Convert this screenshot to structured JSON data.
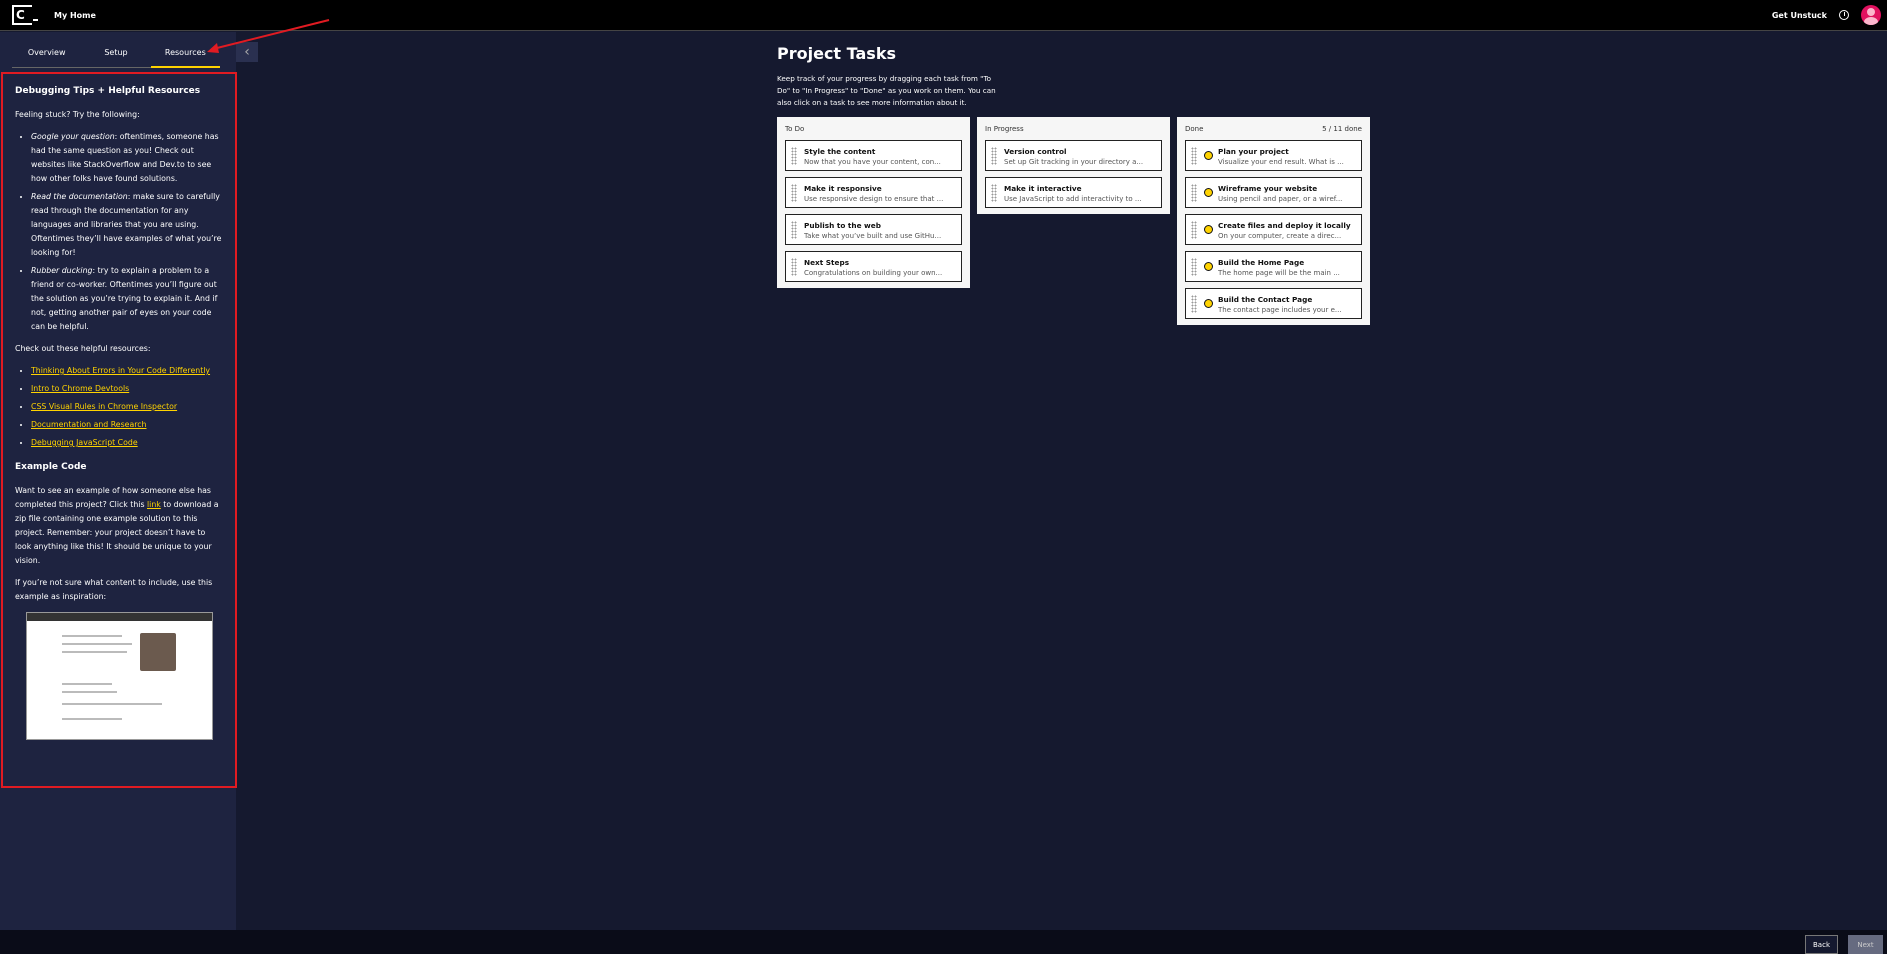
{
  "topbar": {
    "app_title": "My Home",
    "get_unstuck": "Get Unstuck"
  },
  "sidebar": {
    "tabs": [
      {
        "label": "Overview"
      },
      {
        "label": "Setup"
      },
      {
        "label": "Resources"
      }
    ],
    "collapse_icon": "‹",
    "resources": {
      "heading": "Debugging Tips + Helpful Resources",
      "intro": "Feeling stuck? Try the following:",
      "tips": [
        {
          "em": "Google your question",
          "text": ": oftentimes, someone has had the same question as you! Check out websites like StackOverflow and Dev.to to see how other folks have found solutions."
        },
        {
          "em": "Read the documentation",
          "text": ": make sure to carefully read through the documentation for any languages and libraries that you are using. Oftentimes they’ll have examples of what you’re looking for!"
        },
        {
          "em": "Rubber ducking",
          "text": ": try to explain a problem to a friend or co-worker. Oftentimes you’ll figure out the solution as you’re trying to explain it. And if not, getting another pair of eyes on your code can be helpful."
        }
      ],
      "links_intro": "Check out these helpful resources:",
      "links": [
        {
          "label": "Thinking About Errors in Your Code Differently"
        },
        {
          "label": "Intro to Chrome Devtools"
        },
        {
          "label": "CSS Visual Rules in Chrome Inspector"
        },
        {
          "label": "Documentation and Research"
        },
        {
          "label": "Debugging JavaScript Code"
        }
      ],
      "example_heading": "Example Code",
      "example_text_before": "Want to see an example of how someone else has completed this project? Click this ",
      "example_link": "link",
      "example_text_after": " to download a zip file containing one example solution to this project. Remember: your project doesn’t have to look anything like this! It should be unique to your vision.",
      "inspiration_text": "If you’re not sure what content to include, use this example as inspiration:"
    }
  },
  "main": {
    "title": "Project Tasks",
    "description": "Keep track of your progress by dragging each task from \"To Do\" to \"In Progress\" to \"Done\" as you work on them. You can also click on a task to see more information about it.",
    "columns": [
      {
        "label": "To Do",
        "count": "",
        "tasks": [
          {
            "title": "Style the content",
            "desc": "Now that you have your content, con..."
          },
          {
            "title": "Make it responsive",
            "desc": "Use responsive design to ensure that ..."
          },
          {
            "title": "Publish to the web",
            "desc": "Take what you’ve built and use GitHu..."
          },
          {
            "title": "Next Steps",
            "desc": "Congratulations on building your own..."
          }
        ]
      },
      {
        "label": "In Progress",
        "count": "",
        "tasks": [
          {
            "title": "Version control",
            "desc": "Set up Git tracking in your directory a..."
          },
          {
            "title": "Make it interactive",
            "desc": "Use JavaScript to add interactivity to ..."
          }
        ]
      },
      {
        "label": "Done",
        "count": "5 / 11 done",
        "tasks": [
          {
            "title": "Plan your project",
            "desc": "Visualize your end result. What is ..."
          },
          {
            "title": "Wireframe your website",
            "desc": "Using pencil and paper, or a wiref..."
          },
          {
            "title": "Create files and deploy it locally",
            "desc": "On your computer, create a direc..."
          },
          {
            "title": "Build the Home Page",
            "desc": "The home page will be the main ..."
          },
          {
            "title": "Build the Contact Page",
            "desc": "The contact page includes your e..."
          }
        ]
      }
    ]
  },
  "footer": {
    "back_label": "Back",
    "next_label": "Next"
  },
  "colors": {
    "accent": "#ffd300",
    "annotation": "#e11b22",
    "background": "#15192f"
  }
}
